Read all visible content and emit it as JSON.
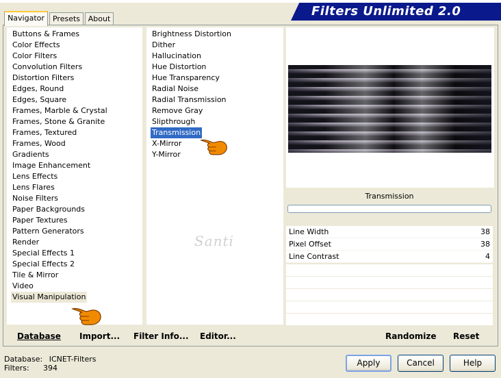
{
  "banner": {
    "title": "Filters Unlimited 2.0"
  },
  "tabs": [
    {
      "label": "Navigator",
      "active": true
    },
    {
      "label": "Presets",
      "active": false
    },
    {
      "label": "About",
      "active": false
    }
  ],
  "categories": {
    "items": [
      "Buttons & Frames",
      "Color Effects",
      "Color Filters",
      "Convolution Filters",
      "Distortion Filters",
      "Edges, Round",
      "Edges, Square",
      "Frames, Marble & Crystal",
      "Frames, Stone & Granite",
      "Frames, Textured",
      "Frames, Wood",
      "Gradients",
      "Image Enhancement",
      "Lens Effects",
      "Lens Flares",
      "Noise Filters",
      "Paper Backgrounds",
      "Paper Textures",
      "Pattern Generators",
      "Render",
      "Special Effects 1",
      "Special Effects 2",
      "Tile & Mirror",
      "Video",
      "Visual Manipulation"
    ],
    "selected": "Visual Manipulation"
  },
  "filters": {
    "items": [
      "Brightness Distortion",
      "Dither",
      "Hallucination",
      "Hue Distortion",
      "Hue Transparency",
      "Radial Noise",
      "Radial Transmission",
      "Remove Gray",
      "Slipthrough",
      "Transmission",
      "X-Mirror",
      "Y-Mirror"
    ],
    "selected": "Transmission"
  },
  "watermark": "Santi",
  "preview": {
    "filter_name": "Transmission"
  },
  "params": [
    {
      "label": "Line Width",
      "value": "38"
    },
    {
      "label": "Pixel Offset",
      "value": "38"
    },
    {
      "label": "Line Contrast",
      "value": "4"
    }
  ],
  "panel_buttons": {
    "database": "Database",
    "import": "Import...",
    "filter_info": "Filter Info...",
    "editor": "Editor...",
    "randomize": "Randomize",
    "reset": "Reset"
  },
  "status": {
    "database_label": "Database:",
    "database_value": "ICNET-Filters",
    "filters_label": "Filters:",
    "filters_value": "394"
  },
  "dialog_buttons": {
    "apply": "Apply",
    "cancel": "Cancel",
    "help": "Help"
  },
  "colors": {
    "banner": "#0a1a8c",
    "selection": "#316ac5",
    "face": "#ece9d8",
    "hand": "#f28a00"
  }
}
